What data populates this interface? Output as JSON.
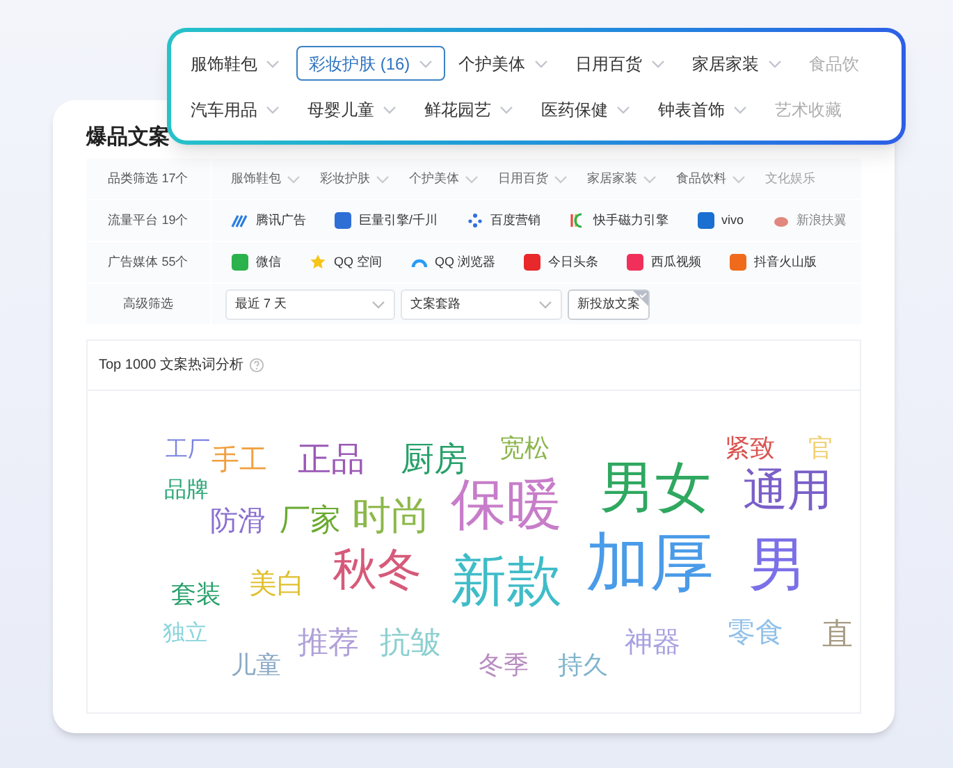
{
  "popup": {
    "rows": [
      [
        {
          "label": "服饰鞋包",
          "selected": false
        },
        {
          "label": "彩妆护肤 (16)",
          "selected": true
        },
        {
          "label": "个护美体",
          "selected": false
        },
        {
          "label": "日用百货",
          "selected": false
        },
        {
          "label": "家居家装",
          "selected": false
        },
        {
          "label": "食品饮",
          "selected": false
        }
      ],
      [
        {
          "label": "汽车用品",
          "selected": false
        },
        {
          "label": "母婴儿童",
          "selected": false
        },
        {
          "label": "鲜花园艺",
          "selected": false
        },
        {
          "label": "医药保健",
          "selected": false
        },
        {
          "label": "钟表首饰",
          "selected": false
        },
        {
          "label": "艺术收藏",
          "selected": false
        }
      ]
    ]
  },
  "page_title": "爆品文案",
  "filters": {
    "category": {
      "label": "品类筛选 17个",
      "items": [
        "服饰鞋包",
        "彩妆护肤",
        "个护美体",
        "日用百货",
        "家居家装",
        "食品饮料",
        "文化娱乐"
      ]
    },
    "platform": {
      "label": "流量平台 19个",
      "items": [
        "腾讯广告",
        "巨量引擎/千川",
        "百度营销",
        "快手磁力引擎",
        "vivo",
        "新浪扶翼"
      ]
    },
    "media": {
      "label": "广告媒体 55个",
      "items": [
        "微信",
        "QQ 空间",
        "QQ 浏览器",
        "今日头条",
        "西瓜视频",
        "抖音火山版"
      ]
    },
    "advanced": {
      "label": "高级筛选",
      "selects": [
        "最近 7 天",
        "文案套路"
      ],
      "tag": {
        "label": "新投放文案",
        "checked": true
      }
    }
  },
  "word_cloud": {
    "title": "Top 1000 文案热词分析",
    "words": [
      {
        "text": "工厂",
        "color": "#7b83e0"
      },
      {
        "text": "手工",
        "color": "#f0a040"
      },
      {
        "text": "正品",
        "color": "#9b59b6"
      },
      {
        "text": "厨房",
        "color": "#27a06a"
      },
      {
        "text": "宽松",
        "color": "#8ab44a"
      },
      {
        "text": "紧致",
        "color": "#d9534f"
      },
      {
        "text": "官",
        "color": "#f0d070"
      },
      {
        "text": "品牌",
        "color": "#2aa876"
      },
      {
        "text": "防滑",
        "color": "#8a6fd0"
      },
      {
        "text": "厂家",
        "color": "#6aaa30"
      },
      {
        "text": "时尚",
        "color": "#8cb84a"
      },
      {
        "text": "保暖",
        "color": "#c77dc9"
      },
      {
        "text": "男女",
        "color": "#2fa860"
      },
      {
        "text": "通用",
        "color": "#7a5fc8"
      },
      {
        "text": "秋冬",
        "color": "#d65a7a"
      },
      {
        "text": "新款",
        "color": "#3fbcc8"
      },
      {
        "text": "加厚",
        "color": "#4a9be8"
      },
      {
        "text": "男",
        "color": "#7b70e8"
      },
      {
        "text": "套装",
        "color": "#27a06a"
      },
      {
        "text": "美白",
        "color": "#e0c030"
      },
      {
        "text": "独立",
        "color": "#8ad4dc"
      },
      {
        "text": "推荐",
        "color": "#b0a0d8"
      },
      {
        "text": "抗皱",
        "color": "#8ccfd0"
      },
      {
        "text": "神器",
        "color": "#a8a0e0"
      },
      {
        "text": "零食",
        "color": "#90c0e8"
      },
      {
        "text": "直",
        "color": "#a89c84"
      },
      {
        "text": "儿童",
        "color": "#8aa8c4"
      },
      {
        "text": "冬季",
        "color": "#b88cc0"
      },
      {
        "text": "持久",
        "color": "#80b4cc"
      }
    ]
  }
}
